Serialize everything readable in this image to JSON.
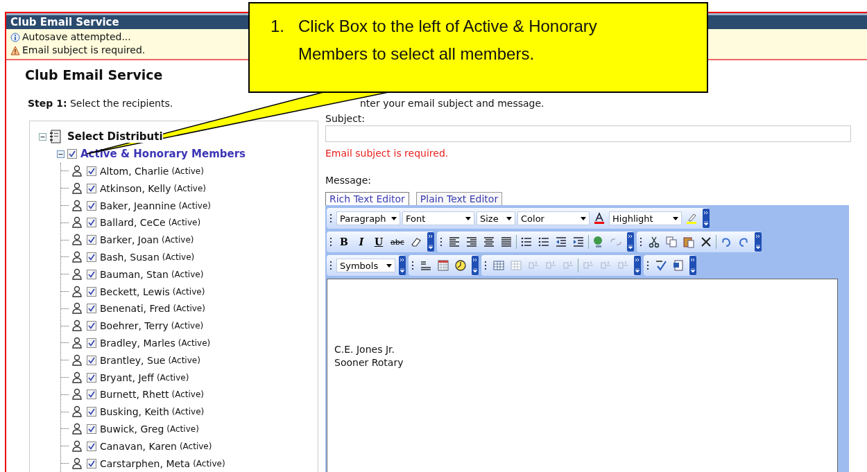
{
  "window": {
    "title": "Club Email Service"
  },
  "notices": [
    {
      "kind": "info",
      "text": "Autosave attempted..."
    },
    {
      "kind": "warning",
      "text": "Email subject is required."
    }
  ],
  "heading": "Club Email Service",
  "step1": {
    "label": "Step 1:",
    "text": "Select the recipients."
  },
  "step2": {
    "text": "nter your email subject and message."
  },
  "tree": {
    "label": "Select Distributi",
    "expanded": true,
    "children": [
      {
        "label": "Active & Honorary Members",
        "expanded": true,
        "checked": true,
        "children": [
          {
            "name": "Altom, Charlie",
            "status": "(Active)",
            "checked": true
          },
          {
            "name": "Atkinson, Kelly",
            "status": "(Active)",
            "checked": true
          },
          {
            "name": "Baker, Jeannine",
            "status": "(Active)",
            "checked": true
          },
          {
            "name": "Ballard, CeCe",
            "status": "(Active)",
            "checked": true
          },
          {
            "name": "Barker, Joan",
            "status": "(Active)",
            "checked": true
          },
          {
            "name": "Bash, Susan",
            "status": "(Active)",
            "checked": true
          },
          {
            "name": "Bauman, Stan",
            "status": "(Active)",
            "checked": true
          },
          {
            "name": "Beckett, Lewis",
            "status": "(Active)",
            "checked": true
          },
          {
            "name": "Benenati, Fred",
            "status": "(Active)",
            "checked": true
          },
          {
            "name": "Boehrer, Terry",
            "status": "(Active)",
            "checked": true
          },
          {
            "name": "Bradley, Marles",
            "status": "(Active)",
            "checked": true
          },
          {
            "name": "Brantley, Sue",
            "status": "(Active)",
            "checked": true
          },
          {
            "name": "Bryant, Jeff",
            "status": "(Active)",
            "checked": true
          },
          {
            "name": "Burnett, Rhett",
            "status": "(Active)",
            "checked": true
          },
          {
            "name": "Busking, Keith",
            "status": "(Active)",
            "checked": true
          },
          {
            "name": "Buwick, Greg",
            "status": "(Active)",
            "checked": true
          },
          {
            "name": "Canavan, Karen",
            "status": "(Active)",
            "checked": true
          },
          {
            "name": "Carstarphen, Meta",
            "status": "(Active)",
            "checked": true
          }
        ]
      }
    ]
  },
  "subject": {
    "label": "Subject:",
    "error": "Email subject is required."
  },
  "message": {
    "label": "Message:"
  },
  "editor_tabs": [
    {
      "label": "Rich Text Editor",
      "selected": true
    },
    {
      "label": "Plain Text Editor",
      "selected": false
    }
  ],
  "dropdowns": [
    "Paragraph",
    "Font",
    "Size",
    "Color",
    "Highlight",
    "Symbols"
  ],
  "format_buttons": [
    "B",
    "I",
    "U",
    "abc"
  ],
  "editor_lines": [
    "C.E. Jones Jr.",
    "Sooner Rotary"
  ],
  "callout": {
    "number": "1.",
    "text": "Click Box to the left of Active & Honorary Members to select all members."
  }
}
